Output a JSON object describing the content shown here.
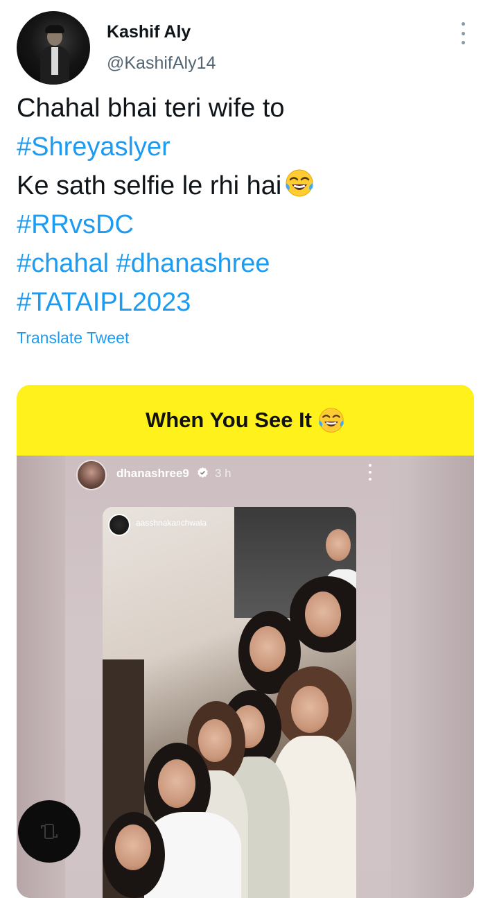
{
  "tweet": {
    "author_name": "Kashif Aly",
    "author_handle": "@KashifAly14",
    "lines": {
      "line1": "Chahal  bhai teri wife to",
      "line2": "#Shreyaslyer",
      "line3": "Ke sath selfie le rhi hai",
      "line4": "#RRvsDC",
      "line5": "#chahal #dhanashree",
      "line6": "#TATAIPL2023"
    },
    "translate_label": "Translate Tweet"
  },
  "media": {
    "caption": "When You See It",
    "story_user": "dhanashree9",
    "story_time": "3 h",
    "tag_user": "aasshnakanchwala"
  },
  "icons": {
    "more": "more-vertical-icon",
    "emoji": "face-with-tears-of-joy-icon",
    "verified": "verified-badge-icon",
    "floating": "rotate-screen-icon"
  },
  "colors": {
    "link": "#1d9bf0",
    "banner": "#fff21c",
    "text": "#0f1419",
    "secondary": "#536471"
  }
}
